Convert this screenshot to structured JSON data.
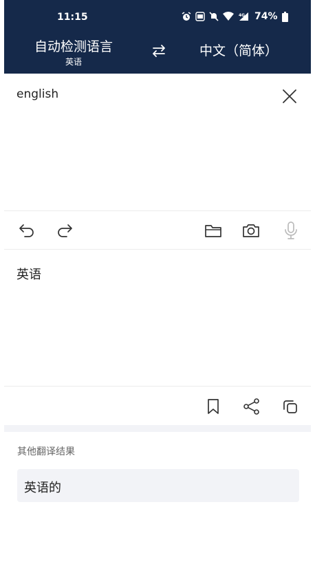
{
  "status": {
    "time": "11:15",
    "battery": "74%"
  },
  "lang_bar": {
    "source_main": "自动检测语言",
    "source_sub": "英语",
    "target": "中文（简体）"
  },
  "input": {
    "text": "english"
  },
  "output": {
    "text": "英语"
  },
  "other": {
    "title": "其他翻译结果",
    "items": [
      "英语的"
    ]
  },
  "colors": {
    "header_bg": "#15294a",
    "icon_gray": "#333333",
    "mic_gray": "#bbbbbb"
  },
  "icons": {
    "toolbar1": [
      "undo-icon",
      "redo-icon",
      "folder-icon",
      "camera-icon",
      "microphone-icon"
    ],
    "toolbar2": [
      "bookmark-icon",
      "share-icon",
      "copy-icon"
    ]
  }
}
